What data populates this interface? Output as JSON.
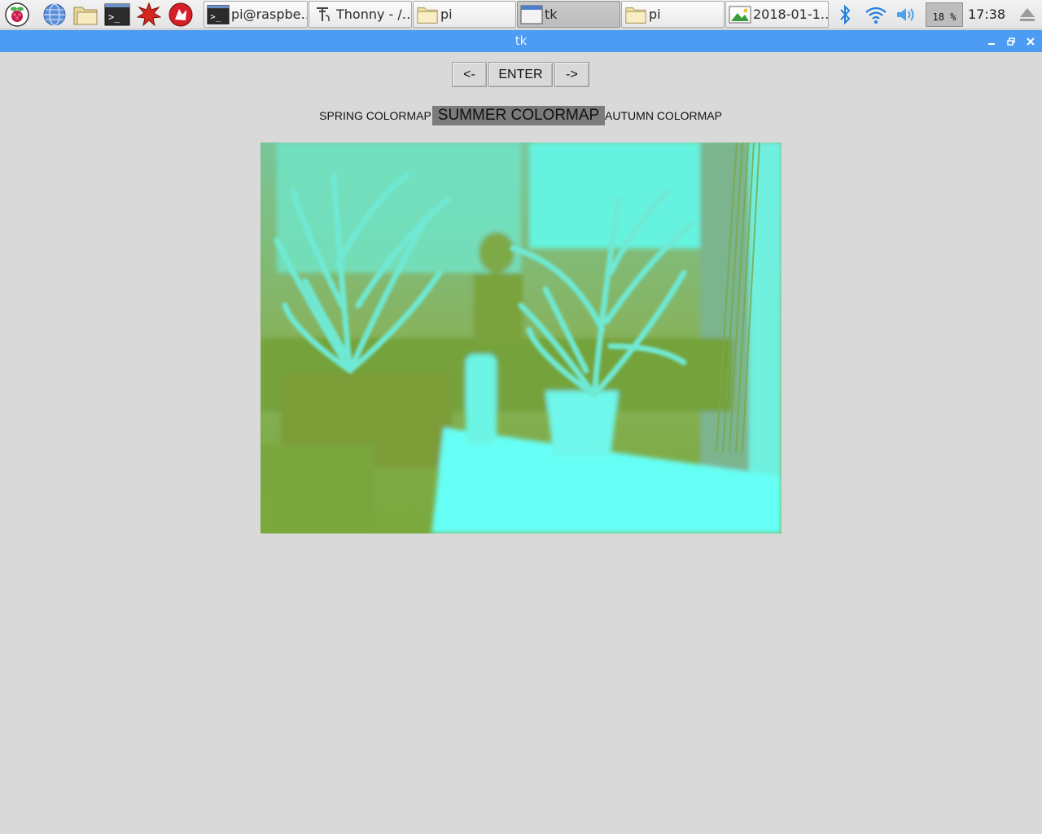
{
  "taskbar": {
    "launchers": [
      {
        "name": "raspberry-menu-icon"
      },
      {
        "name": "web-browser-icon"
      },
      {
        "name": "file-manager-icon"
      },
      {
        "name": "terminal-icon"
      },
      {
        "name": "math-icon"
      },
      {
        "name": "wolfram-icon"
      }
    ],
    "tasks": [
      {
        "label": "pi@raspbe…",
        "icon": "terminal-icon",
        "active": false
      },
      {
        "label": "Thonny  -  /…",
        "icon": "thonny-icon",
        "active": false
      },
      {
        "label": "pi",
        "icon": "folder-icon",
        "active": false
      },
      {
        "label": "tk",
        "icon": "window-icon",
        "active": true
      },
      {
        "label": "pi",
        "icon": "folder-icon",
        "active": false
      },
      {
        "label": "2018-01-1…",
        "icon": "image-viewer-icon",
        "active": false
      }
    ],
    "tray": {
      "icons": [
        "bluetooth-icon",
        "wifi-icon",
        "volume-icon",
        "eject-icon"
      ],
      "cpu_usage": "18 %",
      "clock": "17:38"
    }
  },
  "window": {
    "title": "tk",
    "controls": [
      "minimize-icon",
      "maximize-icon",
      "close-icon"
    ]
  },
  "app": {
    "nav": {
      "prev_label": "<-",
      "enter_label": "ENTER",
      "next_label": "->"
    },
    "colormaps": {
      "items": [
        "SPRING COLORMAP",
        "SUMMER COLORMAP",
        "AUTUMN COLORMAP"
      ],
      "selected": "SUMMER COLORMAP"
    },
    "camera_feed": {
      "description_colors": {
        "low": "#7ba33a",
        "high": "#66fff5"
      }
    }
  }
}
